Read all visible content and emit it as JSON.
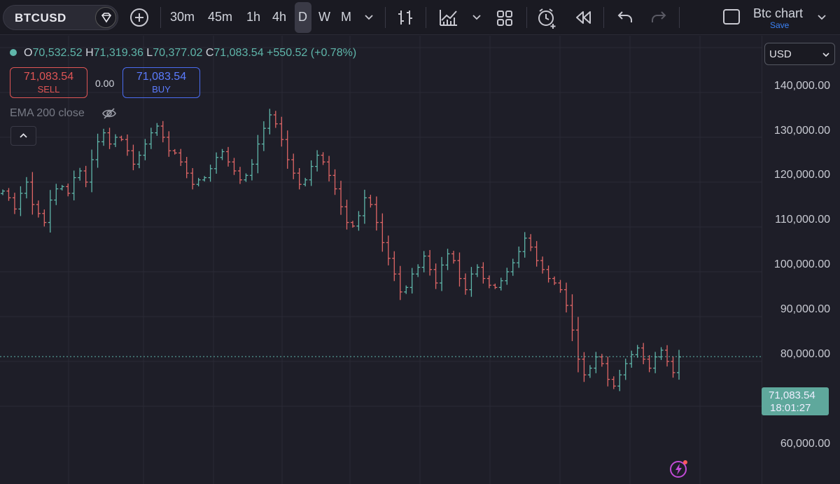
{
  "toolbar": {
    "symbol": "BTCUSD",
    "timeframes": [
      "30m",
      "45m",
      "1h",
      "4h",
      "D",
      "W",
      "M"
    ],
    "active_timeframe": "D",
    "chart_name": "Btc chart",
    "save_label": "Save"
  },
  "legend": {
    "open_label": "O",
    "open": "70,532.52",
    "high_label": "H",
    "high": "71,319.36",
    "low_label": "L",
    "low": "70,377.02",
    "close_label": "C",
    "close": "71,083.54",
    "change": "+550.52 (+0.78%)"
  },
  "trade": {
    "sell_price": "71,083.54",
    "sell_label": "SELL",
    "spread": "0.00",
    "buy_price": "71,083.54",
    "buy_label": "BUY"
  },
  "indicator": {
    "label": "EMA 200 close"
  },
  "price_scale": {
    "currency": "USD",
    "ticks": [
      "140,000.00",
      "130,000.00",
      "120,000.00",
      "110,000.00",
      "100,000.00",
      "90,000.00",
      "80,000.00",
      "60,000.00"
    ],
    "last_price": "71,083.54",
    "countdown": "18:01:27"
  },
  "colors": {
    "up": "#5fb6aa",
    "down": "#e06666",
    "background": "#1e1e28"
  },
  "chart_data": {
    "type": "ohlc",
    "interval": "D",
    "y_range": [
      55000,
      145000
    ],
    "closes": [
      108000,
      106500,
      104000,
      107500,
      110000,
      105000,
      103000,
      101000,
      106000,
      108500,
      109000,
      107500,
      111000,
      112500,
      110000,
      115000,
      119000,
      121000,
      118500,
      120000,
      119500,
      117000,
      114000,
      116000,
      118500,
      121000,
      122500,
      120000,
      117000,
      116500,
      114500,
      112000,
      109500,
      110500,
      111000,
      113000,
      115500,
      116800,
      114500,
      112500,
      110500,
      111500,
      114000,
      118500,
      122000,
      125000,
      123000,
      119500,
      115000,
      112000,
      109500,
      110500,
      113500,
      116000,
      114500,
      111500,
      108500,
      104500,
      101000,
      100200,
      102500,
      106500,
      105000,
      101000,
      96500,
      93000,
      89500,
      85500,
      86500,
      89500,
      91000,
      93500,
      90500,
      87500,
      91500,
      94000,
      92500,
      88500,
      86000,
      89500,
      91000,
      88500,
      87000,
      86500,
      88000,
      90000,
      92000,
      94500,
      97500,
      95500,
      92500,
      90500,
      88500,
      87500,
      86000,
      82500,
      77000,
      70500,
      67000,
      68500,
      71000,
      69500,
      66000,
      64500,
      67000,
      69500,
      71500,
      73000,
      70500,
      68500,
      71000,
      72500,
      70000,
      67500,
      71000
    ],
    "last": 71083.54
  }
}
